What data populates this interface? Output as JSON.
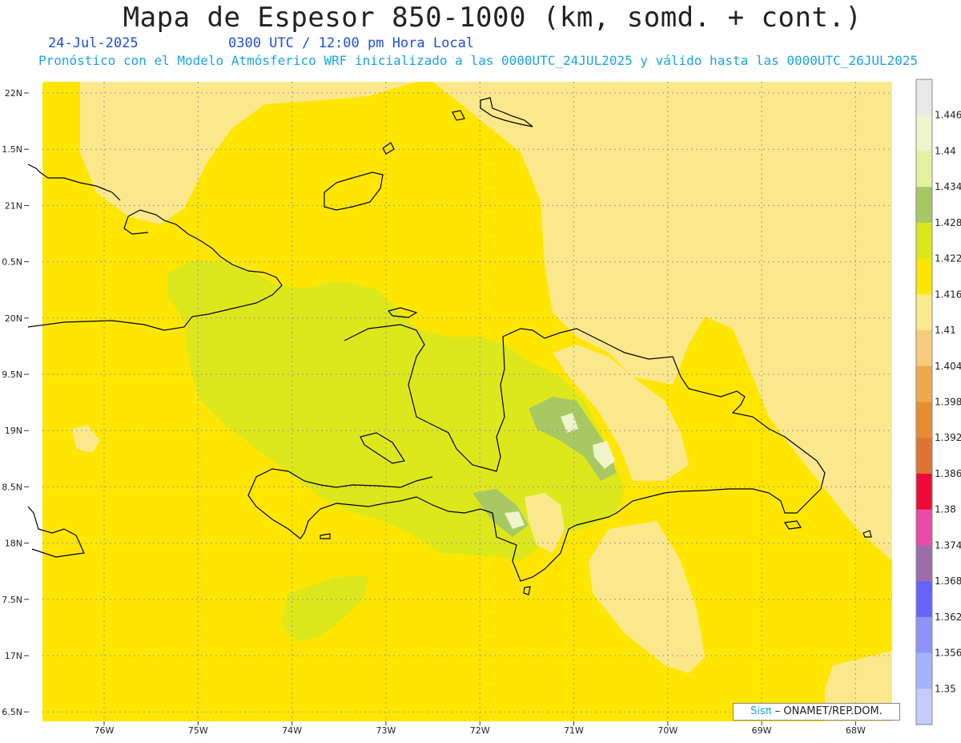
{
  "header": {
    "title": "Mapa de Espesor 850-1000 (km, somd. + cont.)",
    "date": "24-Jul-2025",
    "time": "0300 UTC / 12:00 pm Hora Local",
    "forecast": "Pronóstico con el Modelo Atmósferico WRF inicializado a las 0000UTC_24JUL2025 y válido hasta las  0000UTC_26JUL2025"
  },
  "axes": {
    "lat_labels": [
      "22N",
      "1.5N",
      "21N",
      "0.5N",
      "20N",
      "9.5N",
      "19N",
      "8.5N",
      "18N",
      "7.5N",
      "17N",
      "6.5N"
    ],
    "lon_labels": [
      "76W",
      "75W",
      "74W",
      "73W",
      "72W",
      "71W",
      "70W",
      "69W",
      "68W"
    ]
  },
  "colorbar": {
    "labels": [
      "1.446",
      "1.44",
      "1.434",
      "1.428",
      "1.422",
      "1.416",
      "1.41",
      "1.404",
      "1.398",
      "1.392",
      "1.386",
      "1.38",
      "1.374",
      "1.368",
      "1.362",
      "1.356",
      "1.35"
    ],
    "colors": [
      "#e8e8e8",
      "#eef4cc",
      "#e4f0a0",
      "#a8c864",
      "#dde81c",
      "#ffe600",
      "#fce88c",
      "#f4cc7c",
      "#ecaa4c",
      "#e88c34",
      "#e07434",
      "#ee0a38",
      "#e84ca4",
      "#9c6ca8",
      "#6464fc",
      "#8c94fc",
      "#a4b4fc",
      "#c4ccfc"
    ]
  },
  "colors": {
    "base": "#ffe600",
    "pale": "#fce88c",
    "lime": "#dde81c",
    "olive": "#a8c864",
    "light_green": "#e4f0a0",
    "coast": "#000000",
    "grid": "#9a9a9a",
    "title_blue": "#1f4fd6",
    "subtitle_blue": "#1aa3e8"
  },
  "credit": {
    "logo": "Sisπ",
    "text": "– ONAMET/REP.DOM."
  }
}
